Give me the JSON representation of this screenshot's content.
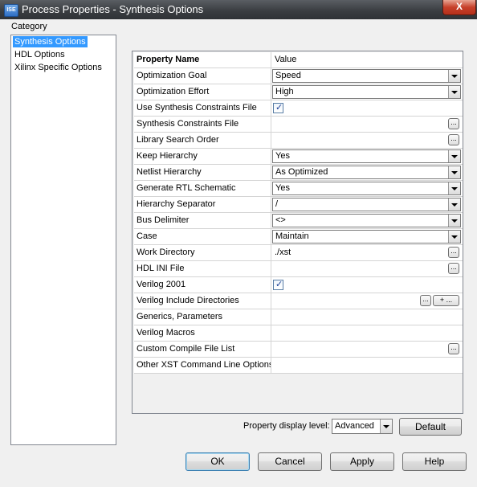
{
  "window": {
    "app_icon_text": "ISE",
    "title": "Process Properties - Synthesis Options",
    "close_glyph": "X"
  },
  "category": {
    "label": "Category",
    "items": [
      {
        "label": "Synthesis Options",
        "selected": true
      },
      {
        "label": "HDL Options",
        "selected": false
      },
      {
        "label": "Xilinx Specific Options",
        "selected": false
      }
    ]
  },
  "table": {
    "header_name": "Property Name",
    "header_value": "Value",
    "rows": [
      {
        "name": "Optimization Goal",
        "type": "combo",
        "value": "Speed"
      },
      {
        "name": "Optimization Effort",
        "type": "combo",
        "value": "High"
      },
      {
        "name": "Use Synthesis Constraints File",
        "type": "checkbox",
        "checked": true
      },
      {
        "name": "Synthesis Constraints File",
        "type": "file",
        "value": ""
      },
      {
        "name": "Library Search Order",
        "type": "file",
        "value": ""
      },
      {
        "name": "Keep Hierarchy",
        "type": "combo",
        "value": "Yes"
      },
      {
        "name": "Netlist Hierarchy",
        "type": "combo",
        "value": "As Optimized"
      },
      {
        "name": "Generate RTL Schematic",
        "type": "combo",
        "value": "Yes"
      },
      {
        "name": "Hierarchy Separator",
        "type": "combo",
        "value": "/"
      },
      {
        "name": "Bus Delimiter",
        "type": "combo",
        "value": "<>"
      },
      {
        "name": "Case",
        "type": "combo",
        "value": "Maintain"
      },
      {
        "name": "Work Directory",
        "type": "file",
        "value": "./xst"
      },
      {
        "name": "HDL INI File",
        "type": "file",
        "value": ""
      },
      {
        "name": "Verilog 2001",
        "type": "checkbox",
        "checked": true
      },
      {
        "name": "Verilog Include Directories",
        "type": "dirs",
        "value": ""
      },
      {
        "name": "Generics, Parameters",
        "type": "text",
        "value": ""
      },
      {
        "name": "Verilog Macros",
        "type": "text",
        "value": ""
      },
      {
        "name": "Custom Compile File List",
        "type": "file",
        "value": ""
      },
      {
        "name": "Other XST Command Line Options",
        "type": "text",
        "value": ""
      }
    ],
    "browse_label": "...",
    "add_label": "+ ..."
  },
  "footer": {
    "display_level_label": "Property display level:",
    "display_level_value": "Advanced",
    "default_button": "Default"
  },
  "buttons": {
    "ok": "OK",
    "cancel": "Cancel",
    "apply": "Apply",
    "help": "Help"
  },
  "icons": {
    "checkbox_mark": "✓"
  }
}
